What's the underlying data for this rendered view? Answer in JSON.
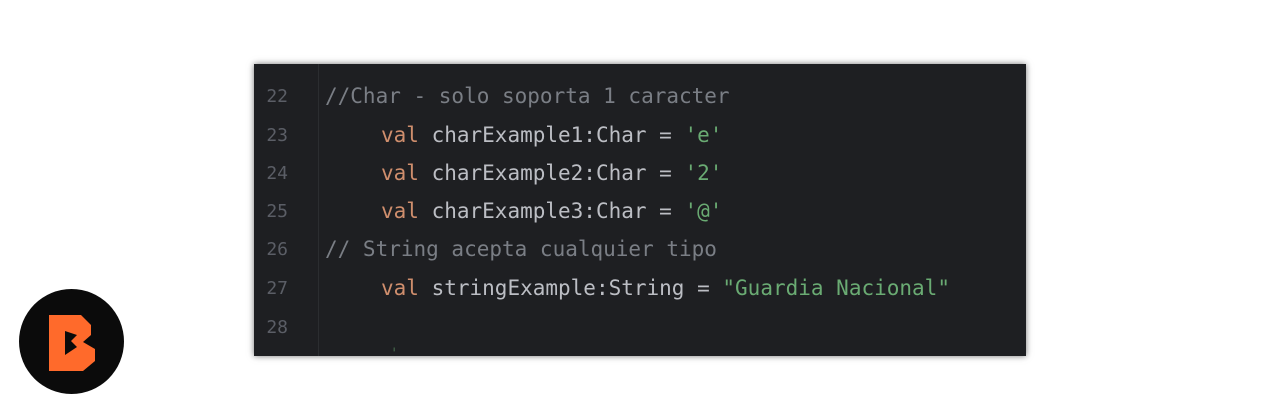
{
  "editor": {
    "lines": [
      {
        "number": "22",
        "comment": "//Char - solo soporta 1 caracter"
      },
      {
        "number": "23",
        "keyword": "val",
        "declaration": "charExample1:Char = ",
        "literal": "'e'"
      },
      {
        "number": "24",
        "keyword": "val",
        "declaration": "charExample2:Char = ",
        "literal": "'2'"
      },
      {
        "number": "25",
        "keyword": "val",
        "declaration": "charExample3:Char = ",
        "literal": "'@'"
      },
      {
        "number": "26",
        "comment": "// String acepta cualquier tipo"
      },
      {
        "number": "27",
        "keyword": "val",
        "declaration": "stringExample:String = ",
        "literal": "\"Guardia Nacional\""
      },
      {
        "number": "28"
      }
    ]
  },
  "colors": {
    "background": "#1e1f22",
    "keyword": "#cf8e6d",
    "string": "#6aab73",
    "comment": "#7a7e85",
    "line_number": "#5b5e66",
    "brand_orange": "#ff6a2b"
  },
  "logo": {
    "icon": "brand-b-logo-icon"
  }
}
